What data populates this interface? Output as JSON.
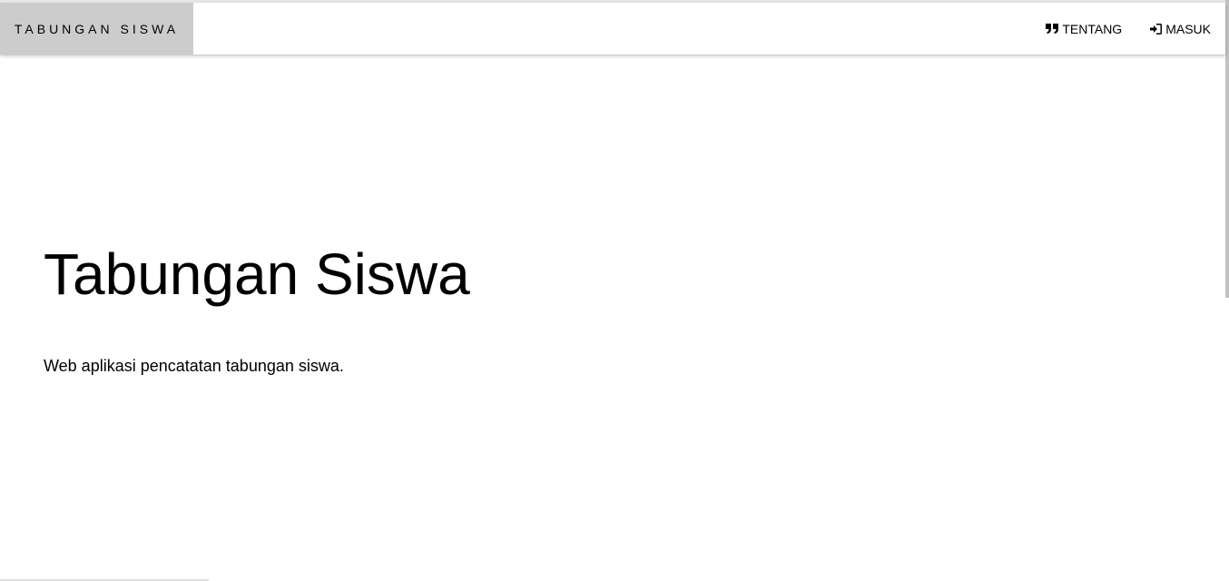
{
  "navbar": {
    "brand": "TABUNGAN SISWA",
    "links": [
      {
        "icon": "quote-right-icon",
        "label": "TENTANG"
      },
      {
        "icon": "sign-in-icon",
        "label": "MASUK"
      }
    ]
  },
  "hero": {
    "title": "Tabungan Siswa",
    "description": "Web aplikasi pencatatan tabungan siswa."
  },
  "colors": {
    "brand_bg": "#cccccc",
    "page_bg": "#ffffff",
    "text": "#000000"
  }
}
